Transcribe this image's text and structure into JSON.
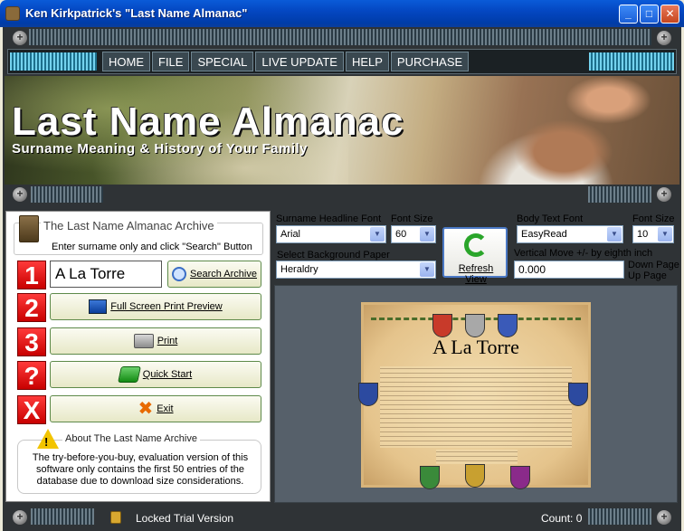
{
  "window": {
    "title": "Ken Kirkpatrick's \"Last Name Almanac\""
  },
  "menu": {
    "items": [
      "HOME",
      "FILE",
      "SPECIAL",
      "LIVE UPDATE",
      "HELP",
      "PURCHASE"
    ]
  },
  "banner": {
    "title": "Last Name Almanac",
    "subtitle": "Surname Meaning & History of Your Family"
  },
  "archive": {
    "title": "The Last Name Almanac Archive",
    "hint": "Enter surname only and click \"Search\" Button",
    "surname_value": "A La Torre",
    "search_label": "Search Archive",
    "preview_label": "Full Screen Print Preview",
    "print_label": "Print",
    "quickstart_label": "Quick Start",
    "exit_label": "Exit",
    "steps": [
      "1",
      "2",
      "3",
      "?",
      "X"
    ]
  },
  "about": {
    "title": "About The Last Name Archive",
    "text": "The try-before-you-buy, evaluation version of this software only contains the first 50 entries of the database due to download size considerations."
  },
  "controls": {
    "headline_font_label": "Surname Headline Font",
    "headline_font_value": "Arial",
    "headline_size_label": "Font Size",
    "headline_size_value": "60",
    "refresh_label": "Refresh View",
    "body_font_label": "Body Text Font",
    "body_font_value": "EasyRead",
    "body_size_label": "Font Size",
    "body_size_value": "10",
    "bg_label": "Select Background Paper",
    "bg_value": "Heraldry",
    "vmove_label": "Vertical Move +/-  by eighth inch",
    "vmove_value": "0.000",
    "down_page": "Down Page",
    "up_page": "Up Page"
  },
  "preview": {
    "surname": "A La Torre"
  },
  "status": {
    "lock_text": "Locked Trial Version",
    "count_text": "Count: 0"
  }
}
